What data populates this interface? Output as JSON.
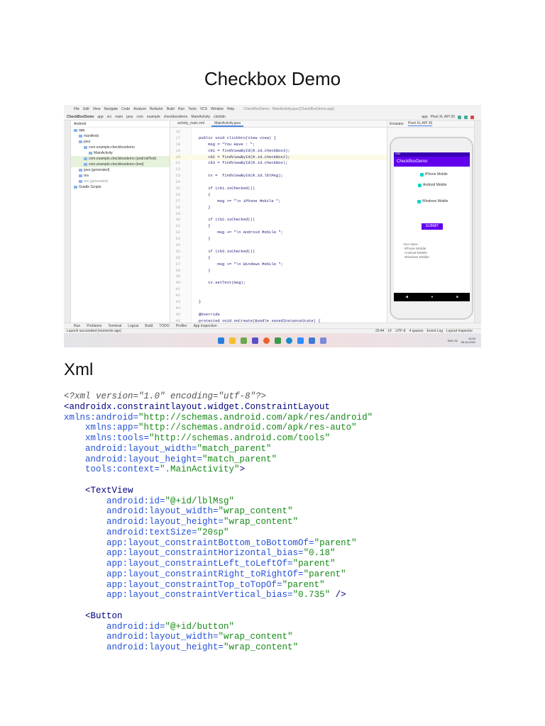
{
  "title": "Checkbox Demo",
  "ide": {
    "menu": [
      "File",
      "Edit",
      "View",
      "Navigate",
      "Code",
      "Analyze",
      "Refactor",
      "Build",
      "Run",
      "Tools",
      "VCS",
      "Window",
      "Help"
    ],
    "window_title": "CheckBoxDemo - MainActivity.java [CheckBoxDemo.app]",
    "breadcrumbs": [
      "CheckBoxDemo",
      "app",
      "src",
      "main",
      "java",
      "com",
      "example",
      "checkboxdemo",
      "MainActivity",
      "clickbtn"
    ],
    "run_config": "app",
    "device": "Pixel XL API 30",
    "project_view": "Android",
    "tree": [
      {
        "label": "app",
        "level": 0
      },
      {
        "label": "manifests",
        "level": 1
      },
      {
        "label": "java",
        "level": 1
      },
      {
        "label": "com.example.checkboxdemo",
        "level": 2
      },
      {
        "label": "MainActivity",
        "level": 3
      },
      {
        "label": "com.example.checkboxdemo (androidTest)",
        "level": 2
      },
      {
        "label": "com.example.checkboxdemo (test)",
        "level": 2
      },
      {
        "label": "java (generated)",
        "level": 1
      },
      {
        "label": "res",
        "level": 1
      },
      {
        "label": "res (generated)",
        "level": 1
      },
      {
        "label": "Gradle Scripts",
        "level": 0
      }
    ],
    "editor_tabs": [
      "activity_main.xml",
      "MainActivity.java"
    ],
    "code": [
      {
        "n": "16",
        "t": ""
      },
      {
        "n": "17",
        "t": "public void clickbtn(View view) {"
      },
      {
        "n": "18",
        "t": "    msg = \"You Have : \";"
      },
      {
        "n": "19",
        "t": "    cb1 = findViewById(R.id.checkBox3);"
      },
      {
        "n": "20",
        "t": "    cb2 = findViewById(R.id.checkBox2);"
      },
      {
        "n": "21",
        "t": "    cb3 = findViewById(R.id.checkBox);"
      },
      {
        "n": "22",
        "t": ""
      },
      {
        "n": "23",
        "t": "    tv =  findViewById(R.id.lblMsg);"
      },
      {
        "n": "24",
        "t": ""
      },
      {
        "n": "25",
        "t": "    if (cb1.isChecked())"
      },
      {
        "n": "26",
        "t": "    {"
      },
      {
        "n": "27",
        "t": "        msg += \"\\n iPhone Mobile \";"
      },
      {
        "n": "28",
        "t": "    }"
      },
      {
        "n": "29",
        "t": ""
      },
      {
        "n": "30",
        "t": "    if (cb2.isChecked())"
      },
      {
        "n": "31",
        "t": "    {"
      },
      {
        "n": "32",
        "t": "        msg += \"\\n Android Mobile \";"
      },
      {
        "n": "33",
        "t": "    }"
      },
      {
        "n": "34",
        "t": ""
      },
      {
        "n": "35",
        "t": "    if (cb3.isChecked())"
      },
      {
        "n": "36",
        "t": "    {"
      },
      {
        "n": "37",
        "t": "        msg += \"\\n Windows Mobile \";"
      },
      {
        "n": "38",
        "t": "    }"
      },
      {
        "n": "39",
        "t": ""
      },
      {
        "n": "40",
        "t": "    tv.setText(msg);"
      },
      {
        "n": "41",
        "t": ""
      },
      {
        "n": "42",
        "t": ""
      },
      {
        "n": "43",
        "t": "}"
      },
      {
        "n": "44",
        "t": ""
      },
      {
        "n": "45",
        "t": "@Override"
      },
      {
        "n": "46",
        "t": "protected void onCreate(Bundle savedInstanceState) {"
      }
    ],
    "emulator": {
      "tab_label": "Emulator",
      "device_tab": "Pixel XL API 30",
      "time": "4:50",
      "app_title": "CheckBoxDemo",
      "checkboxes": [
        "iPhone Mobile",
        "Android Mobile",
        "Windows Mobile"
      ],
      "submit": "SUBMIT",
      "result": [
        "You Have :",
        "iPhone Mobile",
        "Android Mobile",
        "Windows Mobile"
      ]
    },
    "bottom_tabs": [
      "Run",
      "Problems",
      "Terminal",
      "Logcat",
      "Build",
      "TODO",
      "Profiler",
      "App Inspection"
    ],
    "status_text": "Launch succeeded (moments ago)",
    "status_right": [
      "20:44",
      "LF",
      "UTF-8",
      "4 spaces"
    ],
    "status_links": [
      "Event Log",
      "Layout Inspector"
    ],
    "tray": {
      "lang": "ENG IN",
      "time": "10:50",
      "date": "28-04-2022"
    }
  },
  "xml_heading": "Xml",
  "xml_lines": [
    [
      {
        "c": "pi",
        "t": "<?xml version=\"1.0\" encoding=\"utf-8\"?>"
      }
    ],
    [
      {
        "c": "tag",
        "t": "<androidx.constraintlayout.widget.ConstraintLayout"
      }
    ],
    [
      {
        "c": "attr",
        "t": "xmlns:android="
      },
      {
        "c": "val",
        "t": "\"http://schemas.android.com/apk/res/android\""
      }
    ],
    [
      {
        "c": "attr",
        "t": "    xmlns:app="
      },
      {
        "c": "val",
        "t": "\"http://schemas.android.com/apk/res-auto\""
      }
    ],
    [
      {
        "c": "attr",
        "t": "    xmlns:tools="
      },
      {
        "c": "val",
        "t": "\"http://schemas.android.com/tools\""
      }
    ],
    [
      {
        "c": "attr",
        "t": "    android:layout_width="
      },
      {
        "c": "val",
        "t": "\"match_parent\""
      }
    ],
    [
      {
        "c": "attr",
        "t": "    android:layout_height="
      },
      {
        "c": "val",
        "t": "\"match_parent\""
      }
    ],
    [
      {
        "c": "attr",
        "t": "    tools:context="
      },
      {
        "c": "val",
        "t": "\".MainActivity\""
      },
      {
        "c": "tag",
        "t": ">"
      }
    ],
    [
      {
        "c": "",
        "t": ""
      }
    ],
    [
      {
        "c": "tag",
        "t": "    <TextView"
      }
    ],
    [
      {
        "c": "attr",
        "t": "        android:id="
      },
      {
        "c": "val",
        "t": "\"@+id/lblMsg\""
      }
    ],
    [
      {
        "c": "attr",
        "t": "        android:layout_width="
      },
      {
        "c": "val",
        "t": "\"wrap_content\""
      }
    ],
    [
      {
        "c": "attr",
        "t": "        android:layout_height="
      },
      {
        "c": "val",
        "t": "\"wrap_content\""
      }
    ],
    [
      {
        "c": "attr",
        "t": "        android:textSize="
      },
      {
        "c": "val",
        "t": "\"20sp\""
      }
    ],
    [
      {
        "c": "attr",
        "t": "        app:layout_constraintBottom_toBottomOf="
      },
      {
        "c": "val",
        "t": "\"parent\""
      }
    ],
    [
      {
        "c": "attr",
        "t": "        app:layout_constraintHorizontal_bias="
      },
      {
        "c": "val",
        "t": "\"0.18\""
      }
    ],
    [
      {
        "c": "attr",
        "t": "        app:layout_constraintLeft_toLeftOf="
      },
      {
        "c": "val",
        "t": "\"parent\""
      }
    ],
    [
      {
        "c": "attr",
        "t": "        app:layout_constraintRight_toRightOf="
      },
      {
        "c": "val",
        "t": "\"parent\""
      }
    ],
    [
      {
        "c": "attr",
        "t": "        app:layout_constraintTop_toTopOf="
      },
      {
        "c": "val",
        "t": "\"parent\""
      }
    ],
    [
      {
        "c": "attr",
        "t": "        app:layout_constraintVertical_bias="
      },
      {
        "c": "val",
        "t": "\"0.735\""
      },
      {
        "c": "tag",
        "t": " />"
      }
    ],
    [
      {
        "c": "",
        "t": ""
      }
    ],
    [
      {
        "c": "tag",
        "t": "    <Button"
      }
    ],
    [
      {
        "c": "attr",
        "t": "        android:id="
      },
      {
        "c": "val",
        "t": "\"@+id/button\""
      }
    ],
    [
      {
        "c": "attr",
        "t": "        android:layout_width="
      },
      {
        "c": "val",
        "t": "\"wrap_content\""
      }
    ],
    [
      {
        "c": "attr",
        "t": "        android:layout_height="
      },
      {
        "c": "val",
        "t": "\"wrap_content\""
      }
    ]
  ]
}
